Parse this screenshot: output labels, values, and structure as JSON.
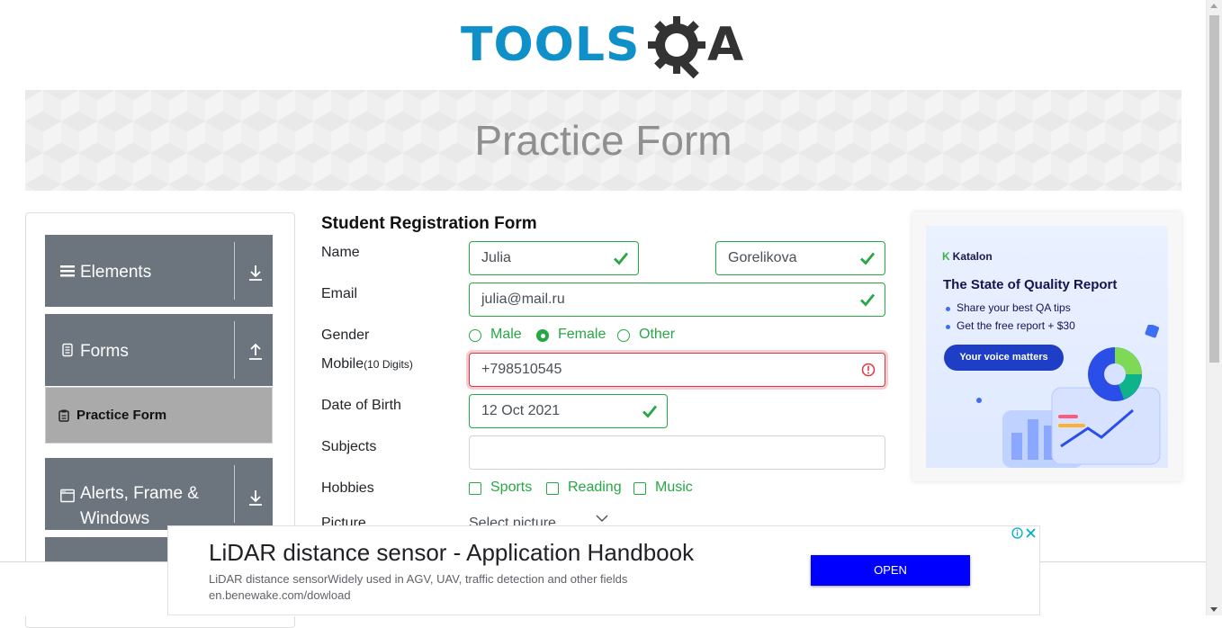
{
  "logo": {
    "tools_text": "TOOLS",
    "a_text": "A"
  },
  "banner": {
    "title": "Practice Form"
  },
  "nav": {
    "groups": [
      {
        "label": "Elements",
        "icon": "hamburger-icon"
      },
      {
        "label": "Forms",
        "icon": "document-icon"
      },
      {
        "label_line1": "Alerts, Frame &",
        "label_line2": "Windows",
        "icon": "browser-window-icon"
      }
    ],
    "active_item": {
      "label": "Practice Form",
      "icon": "clipboard-icon"
    }
  },
  "form": {
    "title": "Student Registration Form",
    "labels": {
      "name": "Name",
      "email": "Email",
      "gender": "Gender",
      "mobile": "Mobile",
      "mobile_hint": "(10 Digits)",
      "dob": "Date of Birth",
      "subjects": "Subjects",
      "hobbies": "Hobbies",
      "picture": "Picture"
    },
    "first_name": "Julia",
    "last_name": "Gorelikova",
    "email": "julia@mail.ru",
    "gender_options": [
      "Male",
      "Female",
      "Other"
    ],
    "gender_selected": "Female",
    "mobile": "+798510545",
    "dob": "12 Oct 2021",
    "subjects": "",
    "hobbies": [
      "Sports",
      "Reading",
      "Music"
    ],
    "picture_placeholder": "Select picture"
  },
  "ad_right": {
    "brand": "Katalon",
    "brand_mark": "K",
    "headline": "The State of Quality Report",
    "bullet1": "Share your best QA tips",
    "bullet2": "Get the free report + $30",
    "cta": "Your voice matters"
  },
  "ad_bottom": {
    "title": "LiDAR distance sensor - Application Handbook",
    "description": "LiDAR distance sensorWidely used in AGV, UAV, traffic detection and other fields",
    "url": "en.benewake.com/dowload",
    "button": "OPEN"
  },
  "colors": {
    "valid": "#28a745",
    "invalid": "#dc3545",
    "nav_bg": "#6c757d",
    "brand_blue": "#1090c8"
  }
}
